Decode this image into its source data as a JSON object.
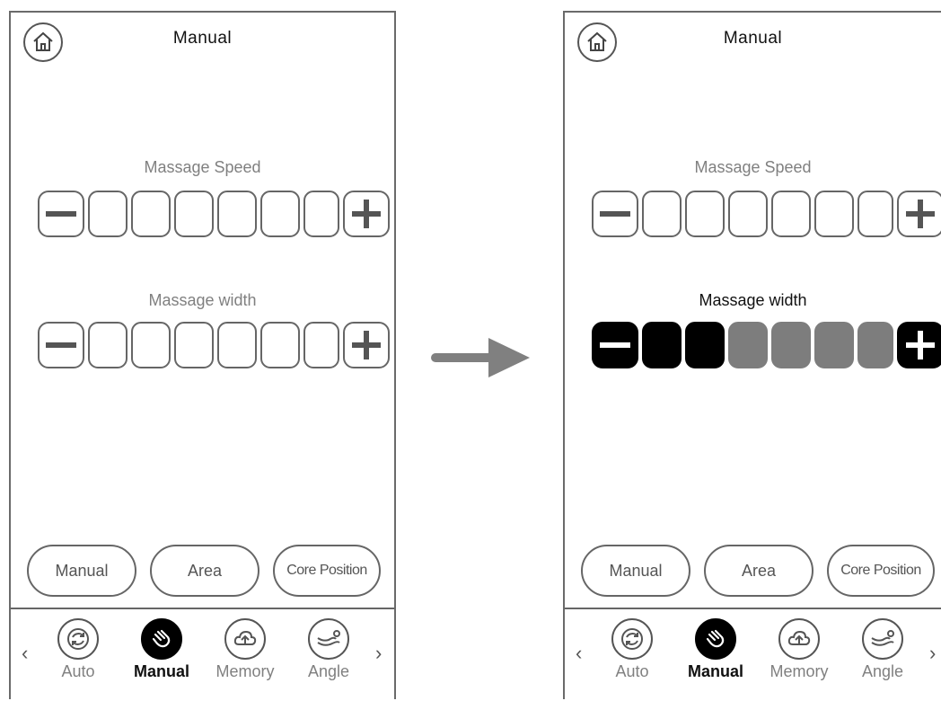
{
  "screens": [
    {
      "title": "Manual",
      "speed": {
        "label": "Massage Speed",
        "segments": 6,
        "level": 0
      },
      "width": {
        "label": "Massage width",
        "segments": 6,
        "level": 0
      },
      "modes": [
        "Manual",
        "Area",
        "Core Position"
      ],
      "tabs": [
        "Auto",
        "Manual",
        "Memory",
        "Angle"
      ],
      "selected_tab": "Manual"
    },
    {
      "title": "Manual",
      "speed": {
        "label": "Massage Speed",
        "segments": 6,
        "level": 0
      },
      "width": {
        "label": "Massage width",
        "segments": 6,
        "level": 2
      },
      "modes": [
        "Manual",
        "Area",
        "Core Position"
      ],
      "tabs": [
        "Auto",
        "Manual",
        "Memory",
        "Angle"
      ],
      "selected_tab": "Manual"
    }
  ],
  "colors": {
    "active": "#000000",
    "inactive_segment": "#7d7d7d",
    "outline": "#666666",
    "muted_text": "#808080"
  },
  "icons": {
    "home": "home-icon",
    "auto": "sync-icon",
    "manual": "hand-massage-icon",
    "memory": "cloud-upload-icon",
    "angle": "recline-icon",
    "prev": "chevron-left-icon",
    "next": "chevron-right-icon",
    "transition": "arrow-right-icon"
  }
}
